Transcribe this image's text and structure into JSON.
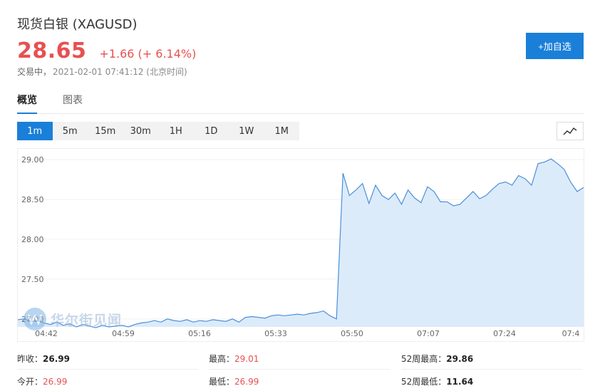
{
  "header": {
    "title": "现货白银  (XAGUSD)",
    "price": "28.65",
    "change": "+1.66 (+ 6.14%)",
    "status": "交易中，",
    "timestamp": "2021-02-01 07:41:12 (北京时间)",
    "add_button": "+加自选"
  },
  "tabs": [
    {
      "label": "概览",
      "active": true
    },
    {
      "label": "图表",
      "active": false
    }
  ],
  "periods": [
    "1m",
    "5m",
    "15m",
    "30m",
    "1H",
    "1D",
    "1W",
    "1M"
  ],
  "active_period": "1m",
  "colors": {
    "up": "#e85050",
    "accent": "#1a7fd8",
    "line": "#4a90d9",
    "fill": "#dcebfa"
  },
  "watermark": {
    "text": "华尔街见闻",
    "icon": "w-logo-icon"
  },
  "chart_data": {
    "type": "area",
    "y_ticks": [
      "29.00",
      "28.50",
      "28.00",
      "27.50",
      "27.00"
    ],
    "x_ticks": [
      "04:42",
      "04:59",
      "05:16",
      "05:33",
      "05:50",
      "07:07",
      "07:24",
      "07:4"
    ],
    "ylim": [
      26.9,
      29.1
    ],
    "grid": true,
    "series": [
      {
        "values": [
          26.99,
          27.0,
          26.97,
          26.98,
          26.95,
          26.93,
          26.96,
          26.92,
          26.94,
          26.9,
          26.93,
          26.91,
          26.89,
          26.92,
          26.9,
          26.91,
          26.92,
          26.9,
          26.93,
          26.95,
          26.96,
          26.98,
          26.96,
          27.0,
          26.98,
          26.97,
          26.99,
          26.96,
          26.98,
          26.97,
          26.99,
          26.98,
          26.97,
          27.0,
          26.96,
          27.02,
          27.03,
          27.02,
          27.01,
          27.04,
          27.05,
          27.04,
          27.05,
          27.06,
          27.05,
          27.07,
          27.08,
          27.1,
          27.04,
          27.0,
          28.83,
          28.55,
          28.62,
          28.7,
          28.45,
          28.68,
          28.55,
          28.5,
          28.58,
          28.44,
          28.62,
          28.52,
          28.46,
          28.66,
          28.6,
          28.47,
          28.47,
          28.42,
          28.44,
          28.52,
          28.6,
          28.51,
          28.55,
          28.63,
          28.7,
          28.72,
          28.68,
          28.8,
          28.76,
          28.68,
          28.95,
          28.97,
          29.01,
          28.95,
          28.88,
          28.72,
          28.6,
          28.65
        ]
      }
    ]
  },
  "stats": {
    "prev_close_label": "昨收：",
    "prev_close": "26.99",
    "open_label": "今开：",
    "open": "26.99",
    "high_label": "最高：",
    "high": "29.01",
    "low_label": "最低：",
    "low": "26.99",
    "high52_label": "52周最高：",
    "high52": "29.86",
    "low52_label": "52周最低：",
    "low52": "11.64"
  }
}
